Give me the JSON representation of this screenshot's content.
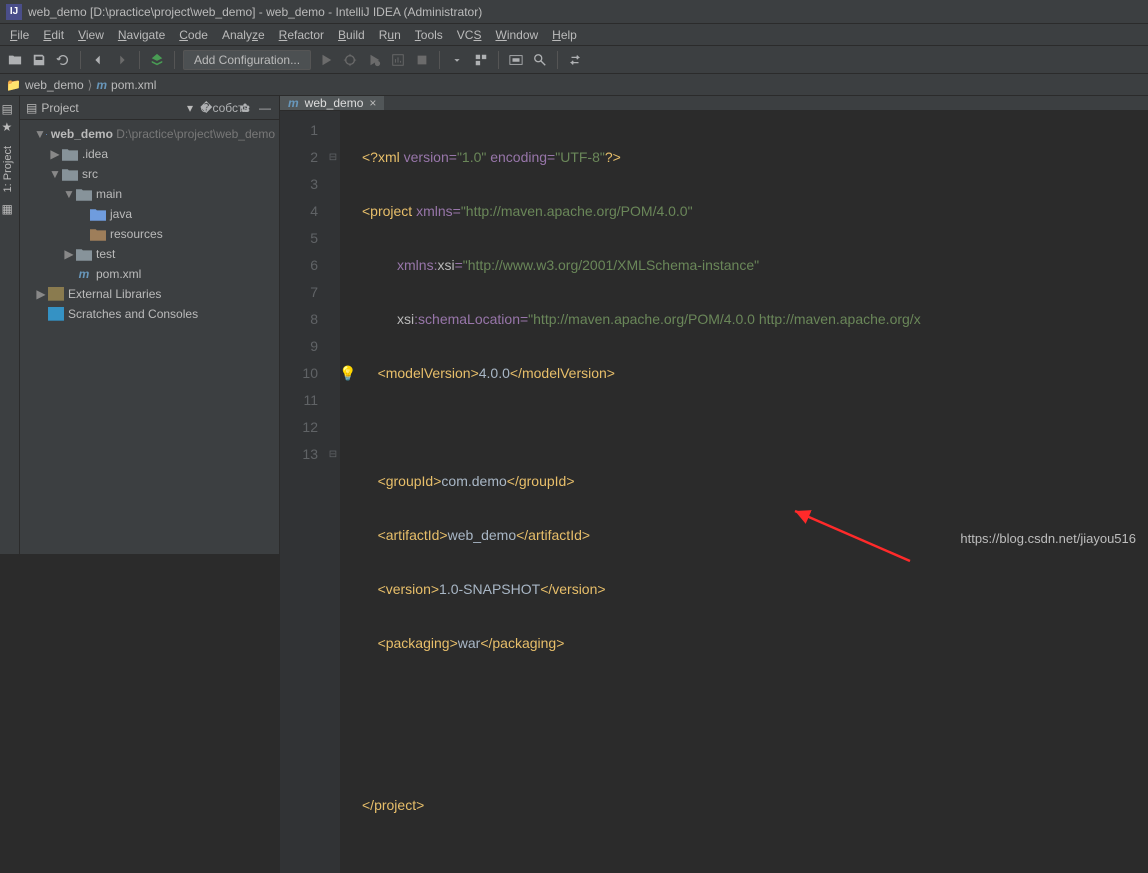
{
  "titlebar": {
    "text": "web_demo [D:\\practice\\project\\web_demo] - web_demo - IntelliJ IDEA (Administrator)"
  },
  "menu": {
    "file": "File",
    "edit": "Edit",
    "view": "View",
    "navigate": "Navigate",
    "code": "Code",
    "analyze": "Analyze",
    "refactor": "Refactor",
    "build": "Build",
    "run": "Run",
    "tools": "Tools",
    "vcs": "VCS",
    "window": "Window",
    "help": "Help"
  },
  "toolbar": {
    "config": "Add Configuration..."
  },
  "breadcrumb": {
    "root": "web_demo",
    "file": "pom.xml"
  },
  "project_panel": {
    "title": "Project",
    "tree": {
      "root": "web_demo",
      "root_path": "D:\\practice\\project\\web_demo",
      "idea": ".idea",
      "src": "src",
      "main": "main",
      "java": "java",
      "resources": "resources",
      "test": "test",
      "pom": "pom.xml",
      "ext_lib": "External Libraries",
      "scratches": "Scratches and Consoles"
    }
  },
  "left_tools": {
    "project": "1: Project"
  },
  "tabs": {
    "active": "web_demo"
  },
  "editor": {
    "lines": [
      "1",
      "2",
      "3",
      "4",
      "5",
      "6",
      "7",
      "8",
      "9",
      "10",
      "11",
      "12",
      "13"
    ],
    "l1_pi_open": "<?xml ",
    "l1_attr1": "version=",
    "l1_v1": "\"1.0\"",
    "l1_sp": " ",
    "l1_attr2": "encoding=",
    "l1_v2": "\"UTF-8\"",
    "l1_pi_close": "?>",
    "l2_open": "<project ",
    "l2_attr": "xmlns=",
    "l2_val": "\"http://maven.apache.org/POM/4.0.0\"",
    "l3_attr_ns": "xmlns:",
    "l3_attr_xsi": "xsi",
    "l3_eq": "=",
    "l3_val": "\"http://www.w3.org/2001/XMLSchema-instance\"",
    "l4_attr_xsi": "xsi",
    "l4_colon": ":",
    "l4_sl": "schemaLocation=",
    "l4_val": "\"http://maven.apache.org/POM/4.0.0 http://maven.apache.org/x",
    "l5_o": "<modelVersion>",
    "l5_t": "4.0.0",
    "l5_c": "</modelVersion>",
    "l7_o": "<groupId>",
    "l7_t": "com.demo",
    "l7_c": "</groupId>",
    "l8_o": "<artifactId>",
    "l8_t": "web_demo",
    "l8_c": "</artifactId>",
    "l9_o": "<version>",
    "l9_t": "1.0-SNAPSHOT",
    "l9_c": "</version>",
    "l10_o": "<packaging>",
    "l10_t": "war",
    "l10_c": "</packaging>",
    "l13": "</project>"
  },
  "watermark": "https://blog.csdn.net/jiayou516"
}
